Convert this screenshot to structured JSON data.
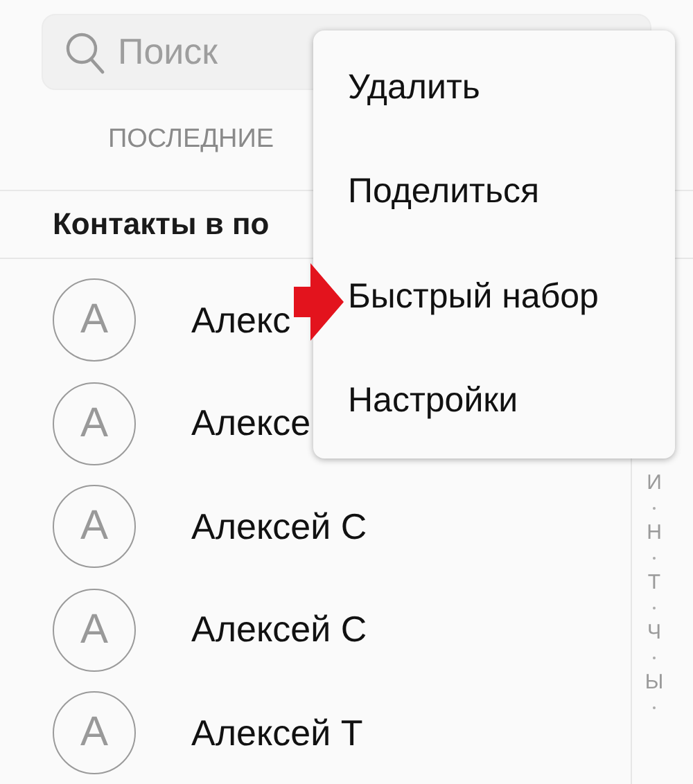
{
  "search": {
    "placeholder": "Поиск"
  },
  "tabs": [
    {
      "label": "ПОСЛЕДНИЕ",
      "selected": false
    }
  ],
  "section_header": "Контакты в по",
  "contacts": [
    {
      "initial": "A",
      "name": "Алекс"
    },
    {
      "initial": "A",
      "name": "Алексе"
    },
    {
      "initial": "A",
      "name": "Алексей С"
    },
    {
      "initial": "A",
      "name": "Алексей С"
    },
    {
      "initial": "A",
      "name": "Алексей Т"
    }
  ],
  "index_letters": [
    "И",
    "Н",
    "Т",
    "Ч",
    "Ы"
  ],
  "menu": {
    "items": [
      "Удалить",
      "Поделиться",
      "Быстрый набор",
      "Настройки"
    ]
  }
}
